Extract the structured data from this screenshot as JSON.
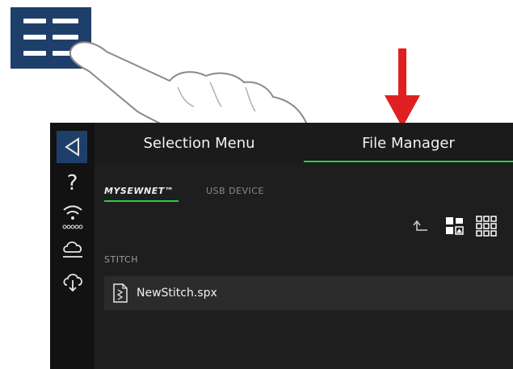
{
  "header": {
    "tabs": [
      {
        "label": "Selection Menu",
        "active": false
      },
      {
        "label": "File Manager",
        "active": true
      }
    ]
  },
  "sidebar": {
    "items": [
      {
        "icon": "back-arrow-icon"
      },
      {
        "icon": "help-icon",
        "label": "?"
      },
      {
        "icon": "wifi-icon"
      },
      {
        "icon": "cloud-icon"
      },
      {
        "icon": "cloud-download-icon"
      }
    ]
  },
  "file_manager": {
    "subtabs": [
      {
        "label": "MYSEWNET™",
        "active": true
      },
      {
        "label": "USB DEVICE",
        "active": false
      }
    ],
    "section_label": "STITCH",
    "files": [
      {
        "name": "NewStitch.spx",
        "icon": "stitch-file-icon"
      }
    ]
  },
  "colors": {
    "accent_green": "#2ecc40",
    "button_blue": "#1f3f6b",
    "arrow_red": "#e02020"
  }
}
